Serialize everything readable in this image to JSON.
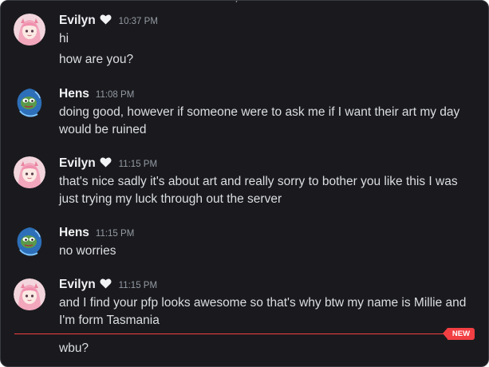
{
  "top_fragment": "y",
  "messages": [
    {
      "author": "Evilyn",
      "timestamp": "10:37 PM",
      "lines": [
        "hi",
        "how are you?"
      ]
    },
    {
      "author": "Hens",
      "timestamp": "11:08 PM",
      "lines": [
        "doing good, however if someone were to ask me if I want their art my day would be ruined"
      ]
    },
    {
      "author": "Evilyn",
      "timestamp": "11:15 PM",
      "lines": [
        "that's nice sadly it's about art and really sorry to bother you like this I was just trying my luck through out the server"
      ]
    },
    {
      "author": "Hens",
      "timestamp": "11:15 PM",
      "lines": [
        "no worries"
      ]
    },
    {
      "author": "Evilyn",
      "timestamp": "11:15 PM",
      "lines": [
        "and I find your pfp looks awesome so that's why btw my name is Millie and I'm form Tasmania"
      ]
    }
  ],
  "new_badge": "NEW",
  "after_divider_message": "wbu?",
  "colors": {
    "background": "#1a1a1e",
    "username": "#f2f3f5",
    "timestamp": "#949ba4",
    "message_text": "#dbdee1",
    "new_divider": "#f23f43"
  },
  "icons": {
    "author_badge": "heart-icon",
    "evilyn_avatar": "anime-girl-avatar",
    "hens_avatar": "blue-frog-avatar"
  }
}
